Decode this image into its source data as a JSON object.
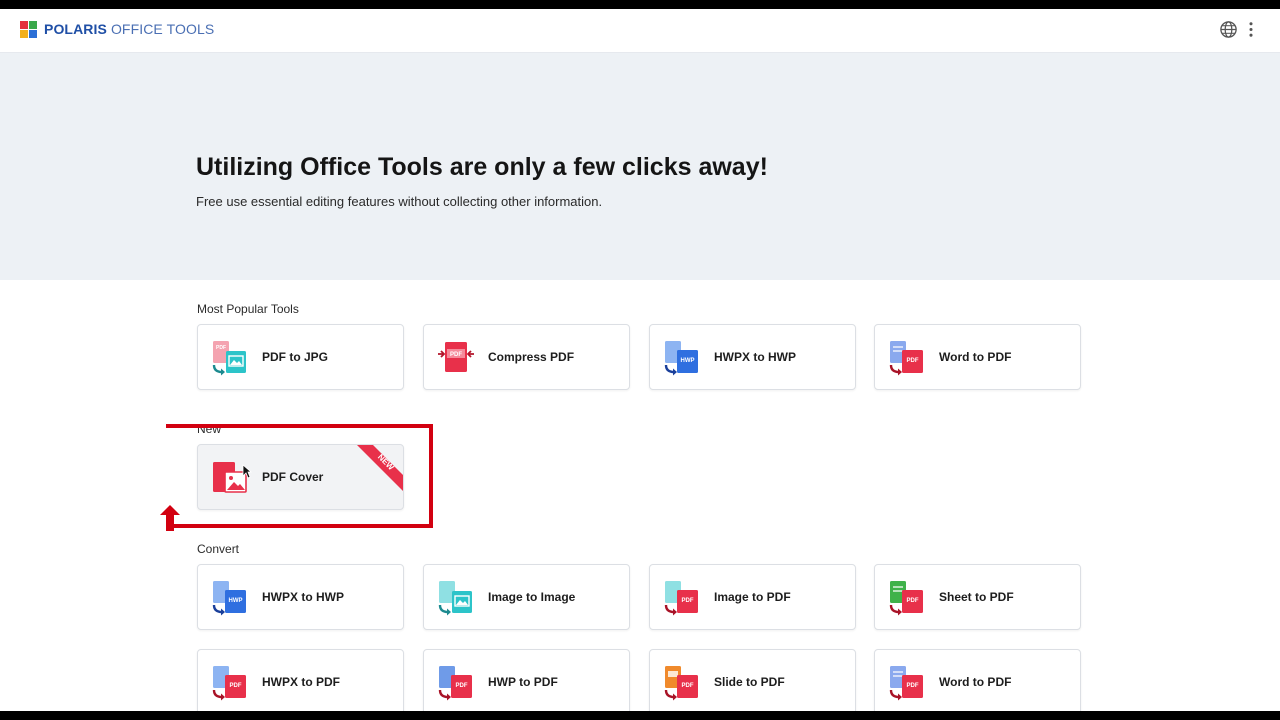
{
  "header": {
    "logo_brand": "POLARIS",
    "logo_product": "OFFICE TOOLS",
    "logo_icon": "polaris-logo-icon",
    "language_icon": "globe-icon",
    "menu_icon": "kebab-menu-icon"
  },
  "hero": {
    "title": "Utilizing Office Tools are only a few clicks away!",
    "subtitle": "Free use essential editing features without collecting other information."
  },
  "sections": {
    "popular": {
      "label": "Most Popular Tools",
      "items": [
        {
          "label": "PDF to JPG",
          "icon": "pdf-to-jpg-icon"
        },
        {
          "label": "Compress PDF",
          "icon": "compress-pdf-icon"
        },
        {
          "label": "HWPX to HWP",
          "icon": "hwpx-to-hwp-icon"
        },
        {
          "label": "Word to PDF",
          "icon": "word-to-pdf-icon"
        }
      ]
    },
    "new": {
      "label": "New",
      "items": [
        {
          "label": "PDF Cover",
          "icon": "pdf-cover-icon",
          "badge": "NEW"
        }
      ]
    },
    "convert": {
      "label": "Convert",
      "items": [
        {
          "label": "HWPX to HWP",
          "icon": "hwpx-to-hwp-icon"
        },
        {
          "label": "Image to Image",
          "icon": "image-to-image-icon"
        },
        {
          "label": "Image to PDF",
          "icon": "image-to-pdf-icon"
        },
        {
          "label": "Sheet to PDF",
          "icon": "sheet-to-pdf-icon"
        },
        {
          "label": "HWPX to PDF",
          "icon": "hwpx-to-pdf-icon"
        },
        {
          "label": "HWP to PDF",
          "icon": "hwp-to-pdf-icon"
        },
        {
          "label": "Slide to PDF",
          "icon": "slide-to-pdf-icon"
        },
        {
          "label": "Word to PDF",
          "icon": "word-to-pdf-icon"
        }
      ]
    }
  },
  "icon_text": {
    "pdf": "PDF",
    "hwp": "HWP"
  },
  "colors": {
    "accent_red": "#e8304a",
    "highlight": "#d20010",
    "hwp_blue": "#2f6fe0",
    "image_teal": "#2cc4c9",
    "sheet_green": "#3fb24a",
    "slide_orange": "#f08a2c",
    "word_blue": "#4a7fe0"
  }
}
